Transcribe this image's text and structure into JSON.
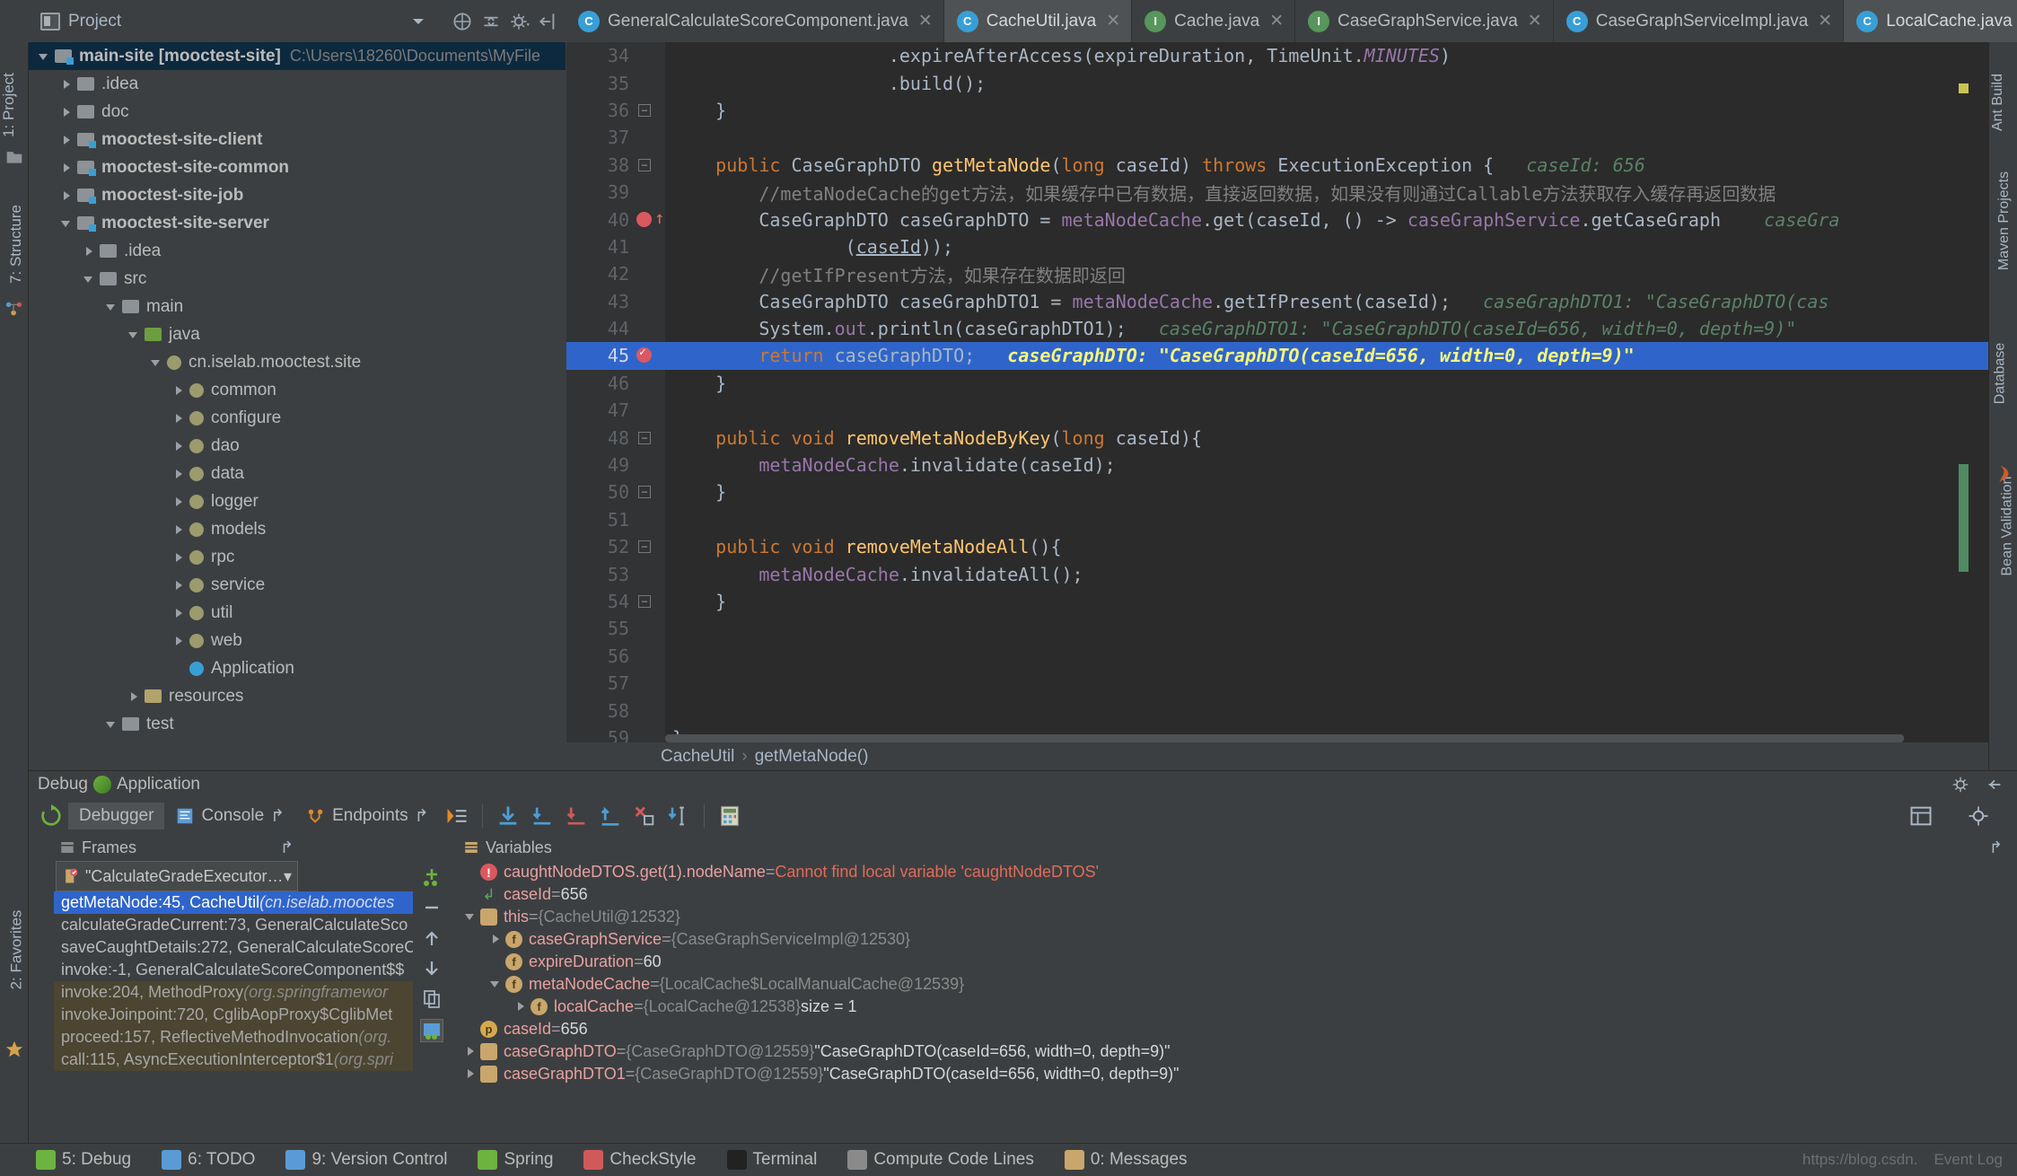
{
  "window": {
    "project_tool_label": "Project",
    "left_vertical_tabs": [
      "1: Project",
      "7: Structure"
    ],
    "left_bottom_tabs": [
      "2: Favorites"
    ],
    "right_vertical_tabs": [
      "Ant Build",
      "Maven Projects",
      "Database",
      "Bean Validation"
    ]
  },
  "tabs": [
    {
      "label": "GeneralCalculateScoreComponent.java",
      "icon": "class-icon",
      "kind": "c",
      "active": false
    },
    {
      "label": "CacheUtil.java",
      "icon": "class-icon",
      "kind": "c",
      "active": true
    },
    {
      "label": "Cache.java",
      "icon": "interface-icon",
      "kind": "i",
      "active": false
    },
    {
      "label": "CaseGraphService.java",
      "icon": "interface-icon",
      "kind": "i",
      "active": false
    },
    {
      "label": "CaseGraphServiceImpl.java",
      "icon": "class-icon",
      "kind": "c",
      "active": false
    },
    {
      "label": "LocalCache.java",
      "icon": "class-icon",
      "kind": "c",
      "active": false
    }
  ],
  "project_tree": [
    {
      "indent": 0,
      "arrow": "down",
      "icon": "module-icon",
      "label": "main-site [mooctest-site]",
      "bold": true,
      "path": "C:\\Users\\18260\\Documents\\MyFile",
      "selected": true
    },
    {
      "indent": 1,
      "arrow": "right",
      "icon": "folder-icon",
      "label": ".idea",
      "bold": false
    },
    {
      "indent": 1,
      "arrow": "right",
      "icon": "folder-icon",
      "label": "doc",
      "bold": false
    },
    {
      "indent": 1,
      "arrow": "right",
      "icon": "module-icon",
      "label": "mooctest-site-client",
      "bold": true
    },
    {
      "indent": 1,
      "arrow": "right",
      "icon": "module-icon",
      "label": "mooctest-site-common",
      "bold": true
    },
    {
      "indent": 1,
      "arrow": "right",
      "icon": "module-icon",
      "label": "mooctest-site-job",
      "bold": true
    },
    {
      "indent": 1,
      "arrow": "down",
      "icon": "module-icon",
      "label": "mooctest-site-server",
      "bold": true
    },
    {
      "indent": 2,
      "arrow": "right",
      "icon": "folder-icon",
      "label": ".idea",
      "bold": false
    },
    {
      "indent": 2,
      "arrow": "down",
      "icon": "folder-icon",
      "label": "src",
      "bold": false
    },
    {
      "indent": 3,
      "arrow": "down",
      "icon": "folder-icon",
      "label": "main",
      "bold": false
    },
    {
      "indent": 4,
      "arrow": "down",
      "icon": "source-folder-icon",
      "label": "java",
      "bold": false
    },
    {
      "indent": 5,
      "arrow": "down",
      "icon": "package-icon",
      "label": "cn.iselab.mooctest.site",
      "bold": false
    },
    {
      "indent": 6,
      "arrow": "right",
      "icon": "package-icon",
      "label": "common",
      "bold": false
    },
    {
      "indent": 6,
      "arrow": "right",
      "icon": "package-icon",
      "label": "configure",
      "bold": false
    },
    {
      "indent": 6,
      "arrow": "right",
      "icon": "package-icon",
      "label": "dao",
      "bold": false
    },
    {
      "indent": 6,
      "arrow": "right",
      "icon": "package-icon",
      "label": "data",
      "bold": false
    },
    {
      "indent": 6,
      "arrow": "right",
      "icon": "package-icon",
      "label": "logger",
      "bold": false
    },
    {
      "indent": 6,
      "arrow": "right",
      "icon": "package-icon",
      "label": "models",
      "bold": false
    },
    {
      "indent": 6,
      "arrow": "right",
      "icon": "package-icon",
      "label": "rpc",
      "bold": false
    },
    {
      "indent": 6,
      "arrow": "right",
      "icon": "package-icon",
      "label": "service",
      "bold": false
    },
    {
      "indent": 6,
      "arrow": "right",
      "icon": "package-icon",
      "label": "util",
      "bold": false
    },
    {
      "indent": 6,
      "arrow": "right",
      "icon": "package-icon",
      "label": "web",
      "bold": false
    },
    {
      "indent": 6,
      "arrow": "none",
      "icon": "class-icon",
      "label": "Application",
      "bold": false
    },
    {
      "indent": 4,
      "arrow": "right",
      "icon": "resource-folder-icon",
      "label": "resources",
      "bold": false
    },
    {
      "indent": 3,
      "arrow": "down",
      "icon": "folder-icon",
      "label": "test",
      "bold": false
    }
  ],
  "editor": {
    "file": "CacheUtil.java",
    "breadcrumb": [
      "CacheUtil",
      "getMetaNode()"
    ],
    "lines": [
      {
        "no": 34,
        "indent": 0,
        "segments": [
          {
            "t": "                    .",
            "c": "typ"
          },
          {
            "t": "expireAfterAccess",
            "c": "typ"
          },
          {
            "t": "(",
            "c": "typ"
          },
          {
            "t": "expireDuration",
            "c": "typ"
          },
          {
            "t": ", ",
            "c": "typ"
          },
          {
            "t": "TimeUnit.",
            "c": "typ"
          },
          {
            "t": "MINUTES",
            "c": "fld-i"
          },
          {
            "t": ")",
            "c": "typ"
          }
        ]
      },
      {
        "no": 35,
        "indent": 0,
        "segments": [
          {
            "t": "                    .",
            "c": "typ"
          },
          {
            "t": "build",
            "c": "typ"
          },
          {
            "t": "();",
            "c": "typ"
          }
        ]
      },
      {
        "no": 36,
        "indent": 0,
        "fold": "minus",
        "segments": [
          {
            "t": "    }",
            "c": "typ"
          }
        ]
      },
      {
        "no": 37,
        "indent": 0,
        "segments": []
      },
      {
        "no": 38,
        "indent": 0,
        "fold": "minus",
        "segments": [
          {
            "t": "    ",
            "c": "typ"
          },
          {
            "t": "public ",
            "c": "kw"
          },
          {
            "t": "CaseGraphDTO ",
            "c": "typ"
          },
          {
            "t": "getMetaNode",
            "c": "mth"
          },
          {
            "t": "(",
            "c": "typ"
          },
          {
            "t": "long ",
            "c": "kw"
          },
          {
            "t": "caseId",
            "c": "typ"
          },
          {
            "t": ") ",
            "c": "typ"
          },
          {
            "t": "throws ",
            "c": "kw"
          },
          {
            "t": "ExecutionException {",
            "c": "typ"
          },
          {
            "t": "   caseId: 656",
            "c": "hint"
          }
        ]
      },
      {
        "no": 39,
        "indent": 0,
        "segments": [
          {
            "t": "        //metaNodeCache的get方法，如果缓存中已有数据，直接返回数据，如果没有则通过Callable方法获取存入缓存再返回数据",
            "c": "cmt"
          }
        ]
      },
      {
        "no": 40,
        "indent": 0,
        "breakpoint": true,
        "segments": [
          {
            "t": "        ",
            "c": "typ"
          },
          {
            "t": "CaseGraphDTO caseGraphDTO = ",
            "c": "typ"
          },
          {
            "t": "metaNodeCache",
            "c": "fld"
          },
          {
            "t": ".get(caseId, () -> ",
            "c": "typ"
          },
          {
            "t": "caseGraphService",
            "c": "fld"
          },
          {
            "t": ".getCaseGraph",
            "c": "typ"
          },
          {
            "t": "    caseGra",
            "c": "hint"
          }
        ]
      },
      {
        "no": 41,
        "indent": 0,
        "segments": [
          {
            "t": "                (",
            "c": "typ"
          },
          {
            "t": "caseId",
            "c": "undl"
          },
          {
            "t": "));",
            "c": "typ"
          }
        ]
      },
      {
        "no": 42,
        "indent": 0,
        "segments": [
          {
            "t": "        //getIfPresent方法，如果存在数据即返回",
            "c": "cmt"
          }
        ]
      },
      {
        "no": 43,
        "indent": 0,
        "segments": [
          {
            "t": "        CaseGraphDTO caseGraphDTO1 = ",
            "c": "typ"
          },
          {
            "t": "metaNodeCache",
            "c": "fld"
          },
          {
            "t": ".getIfPresent(caseId);",
            "c": "typ"
          },
          {
            "t": "   caseGraphDTO1: \"CaseGraphDTO(cas",
            "c": "hint"
          }
        ]
      },
      {
        "no": 44,
        "indent": 0,
        "segments": [
          {
            "t": "        System.",
            "c": "typ"
          },
          {
            "t": "out",
            "c": "fld"
          },
          {
            "t": ".println(caseGraphDTO1);",
            "c": "typ"
          },
          {
            "t": "   caseGraphDTO1: \"CaseGraphDTO(caseId=656, width=0, depth=9)\"",
            "c": "hint"
          }
        ]
      },
      {
        "no": 45,
        "indent": 0,
        "highlight": true,
        "execpoint": true,
        "segments": [
          {
            "t": "        ",
            "c": "typ"
          },
          {
            "t": "return ",
            "c": "kw"
          },
          {
            "t": "caseGraphDTO;",
            "c": "typ"
          },
          {
            "t": "   caseGraphDTO: \"CaseGraphDTO(caseId=656, width=0, depth=9)\"",
            "c": "hint"
          }
        ]
      },
      {
        "no": 46,
        "indent": 0,
        "segments": [
          {
            "t": "    }",
            "c": "typ"
          }
        ]
      },
      {
        "no": 47,
        "indent": 0,
        "segments": []
      },
      {
        "no": 48,
        "indent": 0,
        "fold": "minus",
        "segments": [
          {
            "t": "    ",
            "c": "typ"
          },
          {
            "t": "public void ",
            "c": "kw"
          },
          {
            "t": "removeMetaNodeByKey",
            "c": "mth"
          },
          {
            "t": "(",
            "c": "typ"
          },
          {
            "t": "long ",
            "c": "kw"
          },
          {
            "t": "caseId",
            "c": "typ"
          },
          {
            "t": "){",
            "c": "typ"
          }
        ]
      },
      {
        "no": 49,
        "indent": 0,
        "segments": [
          {
            "t": "        ",
            "c": "typ"
          },
          {
            "t": "metaNodeCache",
            "c": "fld"
          },
          {
            "t": ".invalidate(caseId);",
            "c": "typ"
          }
        ]
      },
      {
        "no": 50,
        "indent": 0,
        "fold": "minus",
        "segments": [
          {
            "t": "    }",
            "c": "typ"
          }
        ]
      },
      {
        "no": 51,
        "indent": 0,
        "segments": []
      },
      {
        "no": 52,
        "indent": 0,
        "fold": "minus",
        "segments": [
          {
            "t": "    ",
            "c": "typ"
          },
          {
            "t": "public void ",
            "c": "kw"
          },
          {
            "t": "removeMetaNodeAll",
            "c": "mth"
          },
          {
            "t": "(){",
            "c": "typ"
          }
        ]
      },
      {
        "no": 53,
        "indent": 0,
        "segments": [
          {
            "t": "        ",
            "c": "typ"
          },
          {
            "t": "metaNodeCache",
            "c": "fld"
          },
          {
            "t": ".invalidateAll();",
            "c": "typ"
          }
        ]
      },
      {
        "no": 54,
        "indent": 0,
        "fold": "minus",
        "segments": [
          {
            "t": "    }",
            "c": "typ"
          }
        ]
      },
      {
        "no": 55,
        "indent": 0,
        "segments": []
      },
      {
        "no": 56,
        "indent": 0,
        "segments": []
      },
      {
        "no": 57,
        "indent": 0,
        "segments": []
      },
      {
        "no": 58,
        "indent": 0,
        "segments": []
      },
      {
        "no": 59,
        "indent": 0,
        "segments": [
          {
            "t": "}",
            "c": "typ"
          }
        ]
      }
    ]
  },
  "debug": {
    "title": "Debug",
    "config_name": "Application",
    "tabs": [
      {
        "label": "Debugger",
        "active": true
      },
      {
        "label": "Console",
        "active": false
      },
      {
        "label": "Endpoints",
        "active": false
      }
    ],
    "frames_title": "Frames",
    "variables_title": "Variables",
    "thread_selector": "\"CalculateGradeExecutor-...",
    "frames": [
      {
        "label": "getMetaNode:45, CacheUtil",
        "pkg": "(cn.iselab.mooctes",
        "selected": true,
        "lib": false
      },
      {
        "label": "calculateGradeCurrent:73, GeneralCalculateSco",
        "pkg": "",
        "selected": false,
        "lib": false
      },
      {
        "label": "saveCaughtDetails:272, GeneralCalculateScoreC",
        "pkg": "",
        "selected": false,
        "lib": false
      },
      {
        "label": "invoke:-1, GeneralCalculateScoreComponent$$",
        "pkg": "",
        "selected": false,
        "lib": false
      },
      {
        "label": "invoke:204, MethodProxy",
        "pkg": "(org.springframewor",
        "selected": false,
        "lib": true
      },
      {
        "label": "invokeJoinpoint:720, CglibAopProxy$CglibMet",
        "pkg": "",
        "selected": false,
        "lib": true
      },
      {
        "label": "proceed:157, ReflectiveMethodInvocation",
        "pkg": "(org.",
        "selected": false,
        "lib": true
      },
      {
        "label": "call:115, AsyncExecutionInterceptor$1",
        "pkg": "(org.spri",
        "selected": false,
        "lib": true
      }
    ],
    "variables": [
      {
        "indent": 0,
        "arrow": "none",
        "icon": "error-icon",
        "name": "caughtNodeDTOS.get(1).nodeName",
        "eq": "=",
        "value": "Cannot find local variable 'caughtNodeDTOS'",
        "value_kind": "error"
      },
      {
        "indent": 0,
        "arrow": "none",
        "icon": "return-icon",
        "name": "caseId",
        "eq": "=",
        "value": "656",
        "value_kind": "num"
      },
      {
        "indent": 0,
        "arrow": "down",
        "icon": "object-icon",
        "name": "this",
        "eq": "=",
        "value": "{CacheUtil@12532}",
        "value_kind": "ref"
      },
      {
        "indent": 1,
        "arrow": "right",
        "icon": "field-icon",
        "name": "caseGraphService",
        "eq": "=",
        "value": "{CaseGraphServiceImpl@12530}",
        "value_kind": "ref"
      },
      {
        "indent": 1,
        "arrow": "none",
        "icon": "field-icon",
        "name": "expireDuration",
        "eq": "=",
        "value": "60",
        "value_kind": "num"
      },
      {
        "indent": 1,
        "arrow": "down",
        "icon": "field-icon",
        "name": "metaNodeCache",
        "eq": "=",
        "value": "{LocalCache$LocalManualCache@12539}",
        "value_kind": "ref"
      },
      {
        "indent": 2,
        "arrow": "right",
        "icon": "field-icon",
        "name": "localCache",
        "eq": "=",
        "value": "{LocalCache@12538}",
        "value_kind": "ref",
        "extra": "size = 1"
      },
      {
        "indent": 0,
        "arrow": "none",
        "icon": "param-icon",
        "name": "caseId",
        "eq": "=",
        "value": "656",
        "value_kind": "num"
      },
      {
        "indent": 0,
        "arrow": "right",
        "icon": "object-icon",
        "name": "caseGraphDTO",
        "eq": "=",
        "value": "{CaseGraphDTO@12559}",
        "value_kind": "ref",
        "str": "\"CaseGraphDTO(caseId=656, width=0, depth=9)\""
      },
      {
        "indent": 0,
        "arrow": "right",
        "icon": "object-icon",
        "name": "caseGraphDTO1",
        "eq": "=",
        "value": "{CaseGraphDTO@12559}",
        "value_kind": "ref",
        "str": "\"CaseGraphDTO(caseId=656, width=0, depth=9)\""
      }
    ]
  },
  "statusbar": {
    "items": [
      {
        "label": "5: Debug",
        "mnemonic": "5",
        "icon": "debug-icon"
      },
      {
        "label": "6: TODO",
        "mnemonic": "6",
        "icon": "todo-icon"
      },
      {
        "label": "9: Version Control",
        "mnemonic": "9",
        "icon": "vcs-icon"
      },
      {
        "label": "Spring",
        "mnemonic": "",
        "icon": "spring-icon"
      },
      {
        "label": "CheckStyle",
        "mnemonic": "",
        "icon": "checkstyle-icon"
      },
      {
        "label": "Terminal",
        "mnemonic": "",
        "icon": "terminal-icon"
      },
      {
        "label": "Compute Code Lines",
        "mnemonic": "",
        "icon": "compute-icon"
      },
      {
        "label": "0: Messages",
        "mnemonic": "0",
        "icon": "messages-icon"
      }
    ],
    "watermark": "https://blog.csdn.",
    "right_label": "Event Log"
  }
}
